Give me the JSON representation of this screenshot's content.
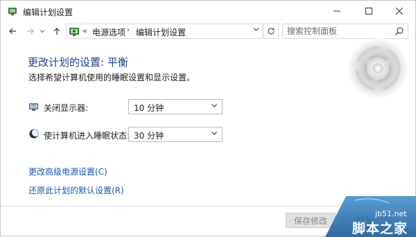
{
  "window": {
    "title": "编辑计划设置",
    "controls": {
      "minimize_icon": "minimize-icon",
      "maximize_icon": "maximize-icon",
      "close_icon": "close-icon"
    }
  },
  "navigation": {
    "back_icon": "arrow-left-icon",
    "forward_icon": "arrow-right-icon",
    "recent_icon": "chevron-down-icon",
    "up_icon": "arrow-up-icon",
    "address": {
      "overflow": "«",
      "crumbs": [
        "电源选项",
        "编辑计划设置"
      ],
      "separator": "›"
    },
    "refresh_icon": "refresh-icon",
    "search": {
      "placeholder": "搜索控制面板",
      "value": "",
      "icon": "search-icon"
    }
  },
  "main": {
    "heading": "更改计划的设置: 平衡",
    "subtitle": "选择希望计算机使用的睡眠设置和显示设置。",
    "settings": [
      {
        "label": "关闭显示器:",
        "value": "10 分钟",
        "icon": "display-clock-icon"
      },
      {
        "label": "使计算机进入睡眠状态:",
        "value": "30 分钟",
        "icon": "moon-icon"
      }
    ],
    "links": {
      "advanced": "更改高级电源设置(C)",
      "restore": "还原此计划的默认设置(R)"
    }
  },
  "footer": {
    "save_label": "保存修改",
    "cancel_label": "取消"
  },
  "watermark": {
    "url": "jb51.net",
    "name": "脚本之家"
  },
  "colors": {
    "heading": "#1b3e8a",
    "link": "#1a54b8",
    "watermark": "#2f78b5"
  }
}
